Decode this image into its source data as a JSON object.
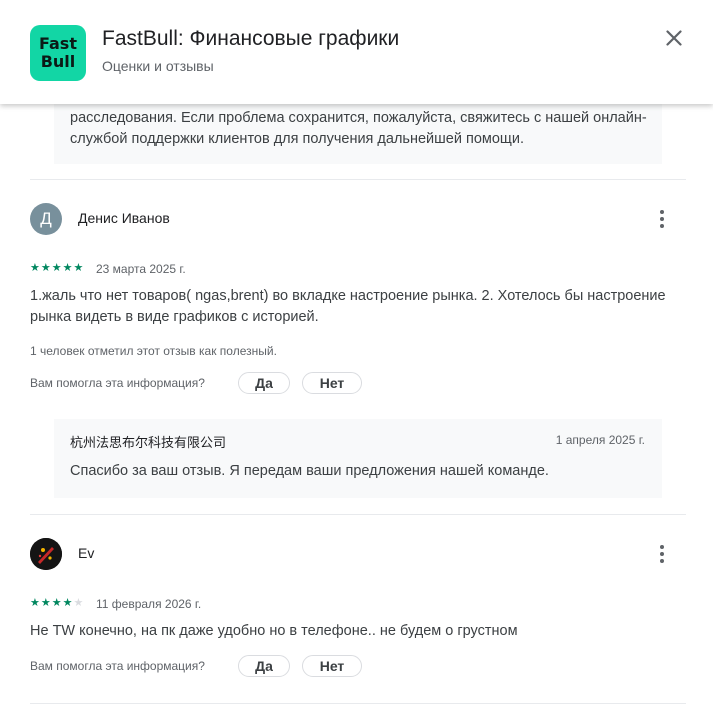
{
  "header": {
    "app_title": "FastBull: Финансовые графики",
    "subtitle": "Оценки и отзывы",
    "logo_line1": "Fast",
    "logo_line2": "Bull",
    "close_icon": "close-icon"
  },
  "previous_reply": {
    "text": "расследования. Если проблема сохранится, пожалуйста, свяжитесь с нашей онлайн-службой поддержки клиентов для получения дальнейшей помощи."
  },
  "reviews": [
    {
      "avatar_letter": "Д",
      "avatar_color": "#78909c",
      "name": "Денис Иванов",
      "rating": 5,
      "date": "23 марта 2025 г.",
      "text": "1.жаль что нет товаров( ngas,brent) во вкладке настроение рынка. 2. Хотелось бы настроение рынка видеть в виде графиков с историей.",
      "helpful_count": "1 человек отметил этот отзыв как полезный.",
      "helpful_question": "Вам помогла эта информация?",
      "yes_label": "Да",
      "no_label": "Нет",
      "reply": {
        "developer": "杭州法思布尔科技有限公司",
        "date": "1 апреля 2025 г.",
        "text": "Спасибо за ваш отзыв. Я передам ваши предложения нашей команде."
      }
    },
    {
      "avatar_icon": "game-avatar-icon",
      "name": "Ev",
      "rating": 4,
      "date": "11 февраля 2026 г.",
      "text": "Не TW конечно, на пк даже удобно но в телефоне.. не будем о грустном",
      "helpful_question": "Вам помогла эта информация?",
      "yes_label": "Да",
      "no_label": "Нет"
    }
  ],
  "colors": {
    "star": "#01875f",
    "logo_bg": "#12d6a5",
    "reply_bg": "#f8f9fa"
  }
}
